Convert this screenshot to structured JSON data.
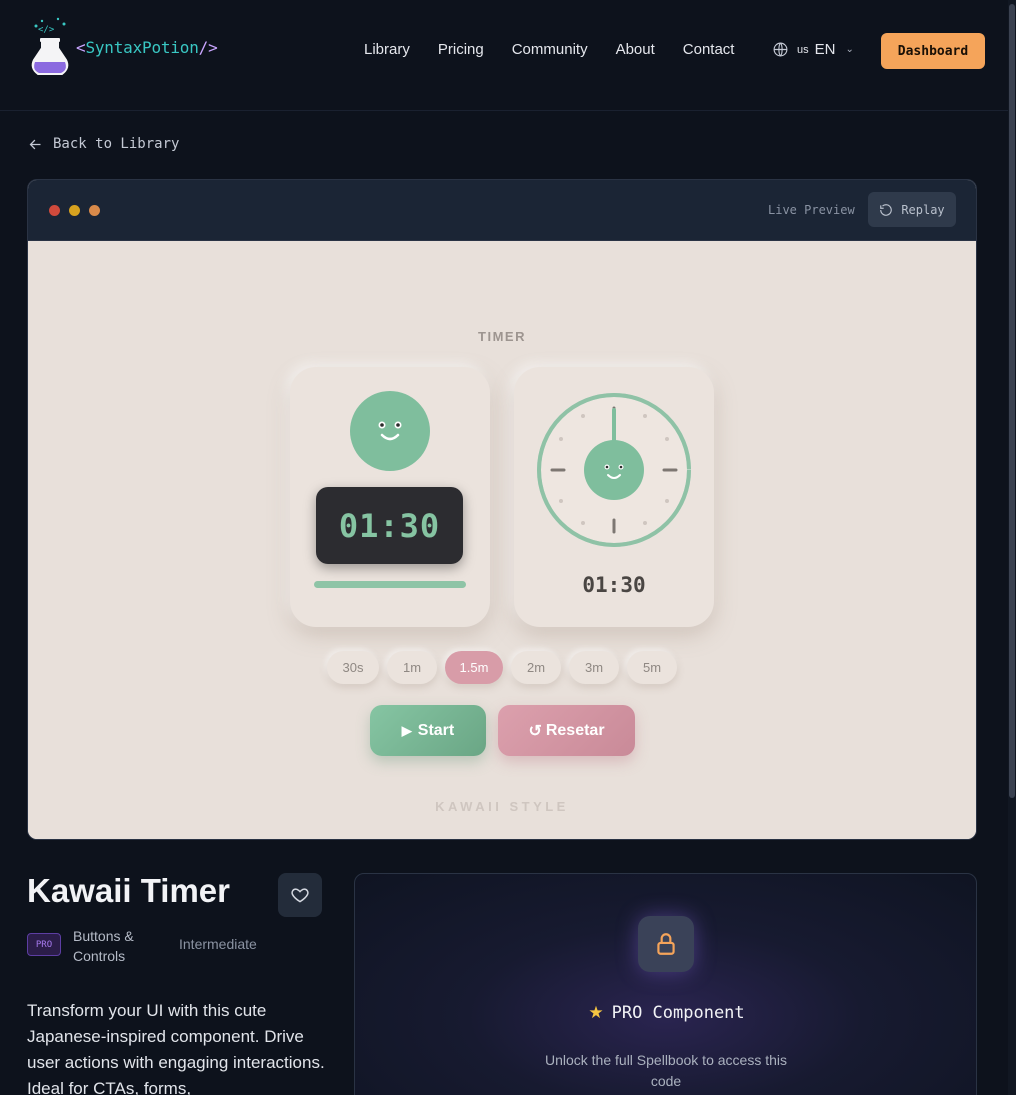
{
  "header": {
    "logo_bracket_open": "<",
    "logo_name": "SyntaxPotion",
    "logo_bracket_close": "/>",
    "nav": [
      "Library",
      "Pricing",
      "Community",
      "About",
      "Contact"
    ],
    "lang_flag": "us",
    "lang_code": "EN",
    "dashboard_label": "Dashboard"
  },
  "back_label": "Back to Library",
  "preview": {
    "live_label": "Live Preview",
    "replay_label": "Replay",
    "window_dots": [
      "#d04a3c",
      "#d7a21f",
      "#d98a4a"
    ],
    "timer_title": "TIMER",
    "digital_time": "01:30",
    "clock_time": "01:30",
    "presets": [
      "30s",
      "1m",
      "1.5m",
      "2m",
      "3m",
      "5m"
    ],
    "active_preset": "1.5m",
    "start_label": "Start",
    "reset_label": "Resetar",
    "style_tag": "KAWAII STYLE"
  },
  "component": {
    "title": "Kawaii Timer",
    "tier_badge": "PRO",
    "category": "Buttons & Controls",
    "level": "Intermediate",
    "description": "Transform your UI with this cute Japanese-inspired component. Drive user actions with engaging interactions. Ideal for CTAs, forms,"
  },
  "pro_panel": {
    "title": "PRO Component",
    "subtitle": "Unlock the full Spellbook to access this code"
  },
  "colors": {
    "accent_orange": "#f5a45a",
    "kawaii_green": "#7fbe9d",
    "kawaii_pink": "#d89ca8",
    "background": "#0d121c"
  }
}
